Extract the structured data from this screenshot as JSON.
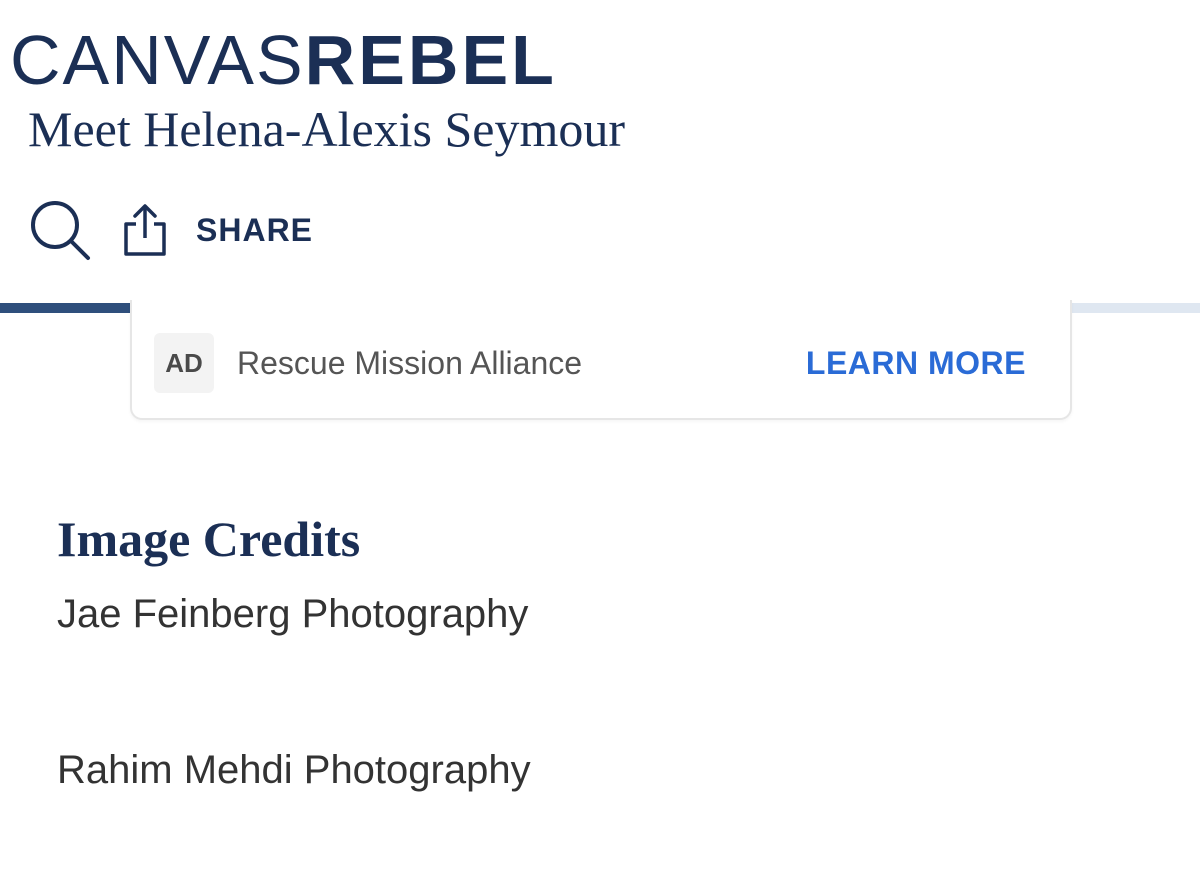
{
  "brand": {
    "thin": "CANVAS",
    "bold": "REBEL"
  },
  "page_title": "Meet Helena-Alexis Seymour",
  "toolbar": {
    "share_label": "SHARE"
  },
  "icons": {
    "search": "search-icon",
    "share": "share-icon"
  },
  "reading_progress_percent": 89,
  "ad": {
    "badge": "AD",
    "title": "Rescue Mission Alliance",
    "cta": "LEARN MORE"
  },
  "credits": {
    "heading": "Image Credits",
    "lines": [
      "Jae Feinberg Photography",
      "Rahim Mehdi Photography"
    ]
  },
  "colors": {
    "brand_navy": "#1b2f55",
    "progress_fill": "#2f4f7c",
    "progress_track": "#dfe7f1",
    "cta_blue": "#2a6bd6"
  }
}
